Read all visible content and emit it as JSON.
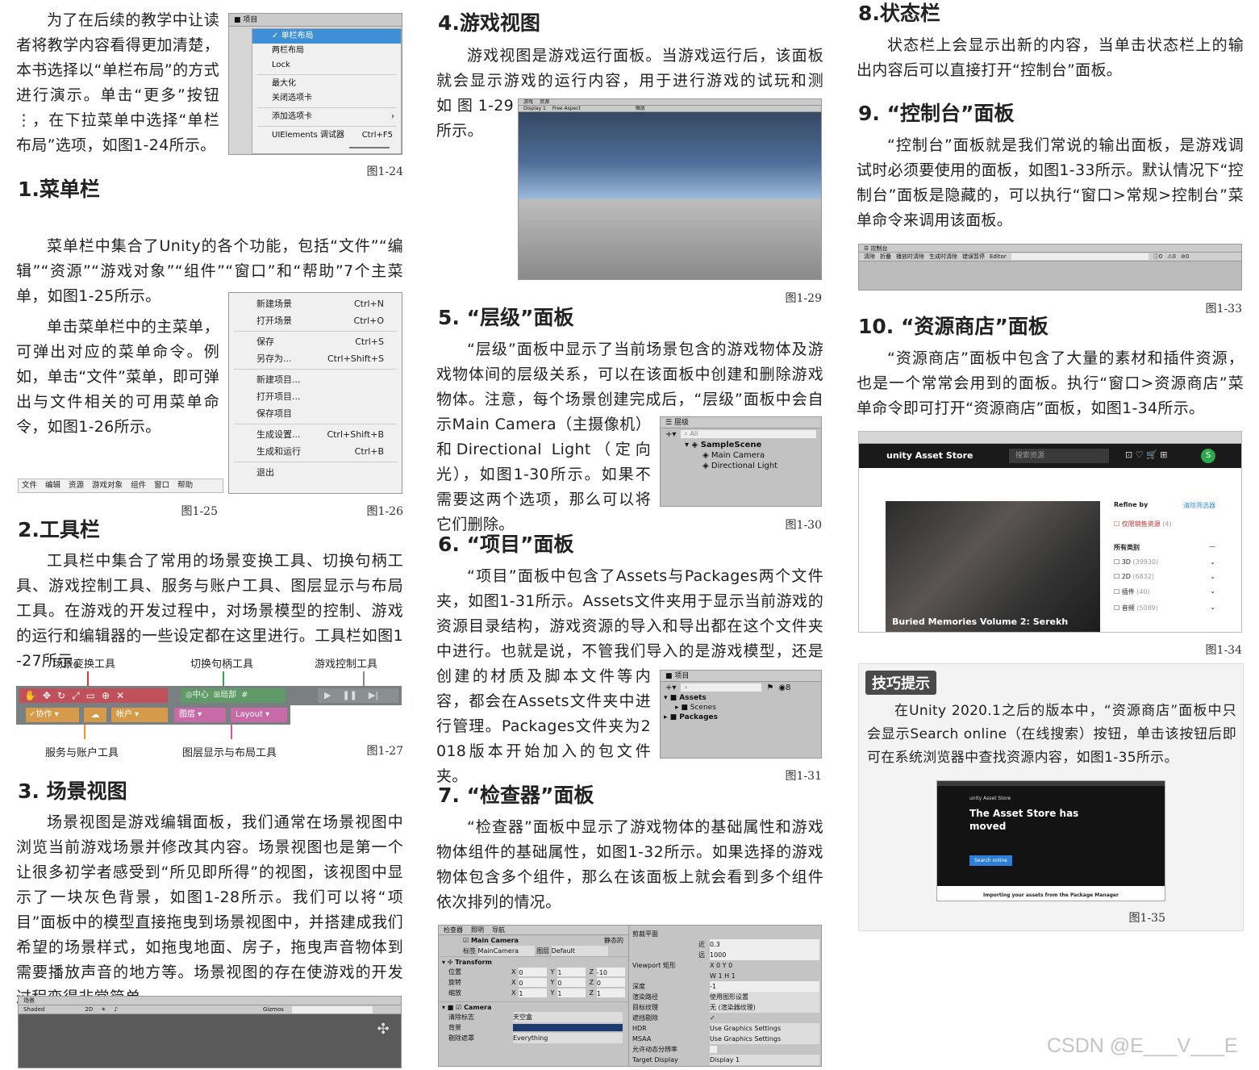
{
  "col1": {
    "intro": "为了在后续的教学中让读者将教学内容看得更加清楚，本书选择以“单栏布局”的方式进行演示。单击“更多”按钮⋮，在下拉菜单中选择“单栏布局”选项，如图1-24所示。",
    "fig24": {
      "tab": "项目",
      "items": [
        "单栏布局",
        "两栏布局",
        "Lock",
        "最大化",
        "关闭选项卡",
        "添加选项卡",
        "UIElements 调试器"
      ],
      "shortcut": "Ctrl+F5",
      "caption": "图1-24"
    },
    "h1": "1.菜单栏",
    "p1a": "菜单栏中集合了Unity的各个功能，包括“文件”“编辑”“资源”“游戏对象”“组件”“窗口”和“帮助”7个主菜单，如图1-25所示。",
    "p1b": "单击菜单栏中的主菜单，可弹出对应的菜单命令。例如，单击“文件”菜单，即可弹出与文件相关的可用菜单命令，如图1-26所示。",
    "fig25": {
      "items": [
        "文件",
        "编辑",
        "资源",
        "游戏对象",
        "组件",
        "窗口",
        "帮助"
      ],
      "caption": "图1-25"
    },
    "fig26": {
      "items": [
        {
          "label": "新建场景",
          "key": "Ctrl+N"
        },
        {
          "label": "打开场景",
          "key": "Ctrl+O"
        },
        {
          "label": "保存",
          "key": "Ctrl+S"
        },
        {
          "label": "另存为...",
          "key": "Ctrl+Shift+S"
        },
        {
          "label": "新建项目...",
          "key": ""
        },
        {
          "label": "打开项目...",
          "key": ""
        },
        {
          "label": "保存项目",
          "key": ""
        },
        {
          "label": "生成设置...",
          "key": "Ctrl+Shift+B"
        },
        {
          "label": "生成和运行",
          "key": "Ctrl+B"
        },
        {
          "label": "退出",
          "key": ""
        }
      ],
      "caption": "图1-26"
    },
    "h2": "2.工具栏",
    "p2": "工具栏中集合了常用的场景变换工具、切换句柄工具、游戏控制工具、服务与账户工具、图层显示与布局工具。在游戏的开发过程中，对场景模型的控制、游戏的运行和编辑器的一些设定都在这里进行。工具栏如图1-27所示。",
    "fig27": {
      "top_labels": [
        "场景变换工具",
        "切换句柄工具",
        "游戏控制工具"
      ],
      "bottom_labels": [
        "服务与账户工具",
        "图层显示与布局工具"
      ],
      "pivot": "中心",
      "local": "局部",
      "collab": "协作",
      "account": "帐户",
      "layers": "图层",
      "layout": "Layout",
      "caption": "图1-27"
    },
    "h3": "3. 场景视图",
    "p3": "场景视图是游戏编辑面板，我们通常在场景视图中浏览当前游戏场景并修改其内容。场景视图也是第一个让很多初学者感受到“所见即所得”的视图，该视图中显示了一块灰色背景，如图1-28所示。我们可以将“项目”面板中的模型直接拖曳到场景视图中，并搭建成我们希望的场景样式，如拖曳地面、房子，拖曳声音物体到需要播放声音的地方等。场景视图的存在使游戏的开发过程变得非常简单。",
    "fig28": {
      "tab": "场景",
      "shaded": "Shaded",
      "mode": "2D",
      "gizmos": "Gizmos"
    }
  },
  "col2": {
    "h4": "4.游戏视图",
    "p4": "游戏视图是游戏运行面板。当游戏运行后，该面板就会显示游戏的运行内容，用于进行游戏的试玩和测试，如图1-29所示。",
    "fig29": {
      "tabs": [
        "游戏",
        "资源"
      ],
      "display": "Display 1",
      "aspect": "Free Aspect",
      "scale": "缩放",
      "caption": "图1-29"
    },
    "h5": "5. “层级”面板",
    "p5": "“层级”面板中显示了当前场景包含的游戏物体及游戏物体间的层级关系，可以在该面板中创建和删除游戏物体。注意，每个场景创建完成后，“层级”面板中会自动显示Main Camera（主摄像机）和Directional Light（定向光），如图1-30所示。如果不需要这两个选项，那么可以将它们删除。",
    "fig30": {
      "tab": "层级",
      "search": "All",
      "scene": "SampleScene",
      "items": [
        "Main Camera",
        "Directional Light"
      ],
      "caption": "图1-30"
    },
    "h6": "6. “项目”面板",
    "p6": "“项目”面板中包含了Assets与Packages两个文件夹，如图1-31所示。Assets文件夹用于显示当前游戏的资源目录结构，游戏资源的导入和导出都在这个文件夹中进行。也就是说，不管我们导入的是游戏模型，还是音乐、视频、创建的材质及脚本文件等内容，都会在Assets文件夹中进行管理。Packages文件夹为2018版本开始加入的包文件夹。",
    "fig31": {
      "tab": "项目",
      "items": [
        "Assets",
        "Scenes",
        "Packages"
      ],
      "count": "8",
      "caption": "图1-31"
    },
    "h7": "7. “检查器”面板",
    "p7": "“检查器”面板中显示了游戏物体的基础属性和游戏物体组件的基础属性，如图1-32所示。如果选择的游戏物体包含多个组件，那么在该面板上就会看到多个组件依次排列的情况。",
    "fig32": {
      "tabs": [
        "检查器",
        "照明",
        "导航"
      ],
      "object": "Main Camera",
      "static": "静态的",
      "tag_label": "标签",
      "tag": "MainCamera",
      "layer_label": "图层",
      "layer": "Default",
      "transform": "Transform",
      "rows": [
        {
          "label": "位置",
          "x": "0",
          "y": "1",
          "z": "-10"
        },
        {
          "label": "旋转",
          "x": "0",
          "y": "0",
          "z": "0"
        },
        {
          "label": "缩放",
          "x": "1",
          "y": "1",
          "z": "1"
        }
      ],
      "camera": "Camera",
      "clear_label": "清除标志",
      "clear": "天空盒",
      "bg_label": "背景",
      "cull_label": "剔除遮罩",
      "cull": "Everything",
      "right_rows": [
        {
          "label": "剪裁平面",
          "value": ""
        },
        {
          "label": "近",
          "value": "0.3"
        },
        {
          "label": "远",
          "value": "1000"
        },
        {
          "label": "Viewport 矩形",
          "value": ""
        },
        {
          "label": "深度",
          "value": "-1"
        },
        {
          "label": "渲染路径",
          "value": "使用图形设置"
        },
        {
          "label": "目标纹理",
          "value": "无 (渲染器纹理)"
        },
        {
          "label": "遮挡剔除",
          "value": "✓"
        },
        {
          "label": "HDR",
          "value": "Use Graphics Settings"
        },
        {
          "label": "MSAA",
          "value": "Use Graphics Settings"
        },
        {
          "label": "允许动态分辨率",
          "value": ""
        },
        {
          "label": "Target Display",
          "value": "Display 1"
        }
      ],
      "vp": {
        "x": "0",
        "y": "0",
        "w": "1",
        "h": "1"
      }
    }
  },
  "col3": {
    "h8": "8.状态栏",
    "p8": "状态栏上会显示出新的内容，当单击状态栏上的输出内容后可以直接打开“控制台”面板。",
    "h9": "9. “控制台”面板",
    "p9": "“控制台”面板就是我们常说的输出面板，是游戏调试时必须要使用的面板，如图1-33所示。默认情况下“控制台”面板是隐藏的，可以执行“窗口>常规>控制台”菜单命令来调用该面板。",
    "fig33": {
      "tab": "控制台",
      "buttons": [
        "清除",
        "折叠",
        "播放时清除",
        "生成时清除",
        "错误暂停",
        "Editor"
      ],
      "counts": [
        "0",
        "0",
        "0"
      ],
      "caption": "图1-33"
    },
    "h10": "10. “资源商店”面板",
    "p10": "“资源商店”面板中包含了大量的素材和插件资源，也是一个常常会用到的面板。执行“窗口>资源商店”菜单命令即可打开“资源商店”面板，如图1-34所示。",
    "fig34": {
      "brand": "unity Asset Store",
      "search": "搜索资源",
      "banner": "Buried Memories Volume 2: Serekh",
      "refine": "Refine by",
      "clear": "清除筛选器",
      "free": "仅限销售资源",
      "free_count": "(4)",
      "cat_title": "所有类别",
      "cats": [
        {
          "label": "3D",
          "count": "(39930)"
        },
        {
          "label": "2D",
          "count": "(6832)"
        },
        {
          "label": "插件",
          "count": "(40)"
        },
        {
          "label": "音频",
          "count": "(5089)"
        }
      ],
      "caption": "图1-34"
    },
    "tip": {
      "badge": "技巧提示",
      "text": "在Unity 2020.1之后的版本中，“资源商店”面板中只会显示Search online（在线搜索）按钮，单击该按钮后即可在系统浏览器中查找资源内容，如图1-35所示。",
      "fig35": {
        "brand": "unity Asset Store",
        "title": "The Asset Store has moved",
        "button": "Search online",
        "footer": "Importing your assets from the Package Manager",
        "caption": "图1-35"
      }
    },
    "watermark": "CSDN @E___V___E"
  },
  "colors": {
    "unity_gray": "#c8c8c8",
    "select_blue": "#3d8fd6",
    "red_arrow": "#e2383c",
    "green_arrow": "#2ea84d",
    "orange_arrow": "#f0912d",
    "pink_arrow": "#e44d9c"
  }
}
